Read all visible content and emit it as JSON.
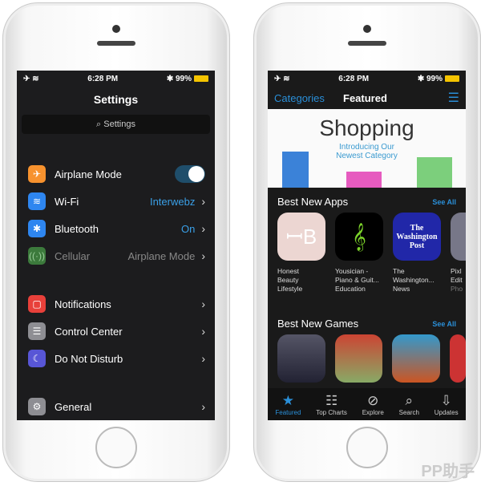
{
  "left": {
    "status": {
      "time": "6:28 PM",
      "battery": "99%"
    },
    "title": "Settings",
    "search_placeholder": "Settings",
    "group1": [
      {
        "label": "Airplane Mode",
        "icon": "airplane-icon",
        "color": "#f7922e",
        "toggle_on": true
      },
      {
        "label": "Wi-Fi",
        "value": "Interwebz",
        "icon": "wifi-icon",
        "color": "#2e86f0"
      },
      {
        "label": "Bluetooth",
        "value": "On",
        "icon": "bluetooth-icon",
        "color": "#2e86f0"
      },
      {
        "label": "Cellular",
        "value": "Airplane Mode",
        "icon": "cellular-icon",
        "color": "#3c7a3c",
        "disabled": true
      }
    ],
    "group2": [
      {
        "label": "Notifications",
        "icon": "notifications-icon",
        "color": "#e8403a"
      },
      {
        "label": "Control Center",
        "icon": "control-center-icon",
        "color": "#8e8e93"
      },
      {
        "label": "Do Not Disturb",
        "icon": "moon-icon",
        "color": "#5856d6"
      }
    ],
    "group3": [
      {
        "label": "General",
        "icon": "gear-icon",
        "color": "#8e8e93"
      }
    ]
  },
  "right": {
    "status": {
      "time": "6:28 PM",
      "battery": "99%"
    },
    "nav": {
      "left": "Categories",
      "title": "Featured"
    },
    "banner": {
      "title": "Shopping",
      "subtitle1": "Introducing Our",
      "subtitle2": "Newest Category"
    },
    "apps_section": {
      "title": "Best New Apps",
      "see_all": "See All",
      "apps": [
        {
          "l1": "Honest",
          "l2": "Beauty",
          "l3": "Lifestyle"
        },
        {
          "l1": "Yousician -",
          "l2": "Piano & Guit...",
          "l3": "Education"
        },
        {
          "l1": "The",
          "l2": "Washington...",
          "l3": "News",
          "logo": "The Washington Post"
        },
        {
          "l1": "Pixl",
          "l2": "Edit",
          "l3": "Pho"
        }
      ]
    },
    "games_section": {
      "title": "Best New Games",
      "see_all": "See All"
    },
    "tabs": [
      {
        "label": "Featured",
        "icon": "star-icon",
        "active": true
      },
      {
        "label": "Top Charts",
        "icon": "list-icon"
      },
      {
        "label": "Explore",
        "icon": "compass-icon"
      },
      {
        "label": "Search",
        "icon": "search-icon"
      },
      {
        "label": "Updates",
        "icon": "download-icon"
      }
    ]
  },
  "watermark": "PP助手"
}
